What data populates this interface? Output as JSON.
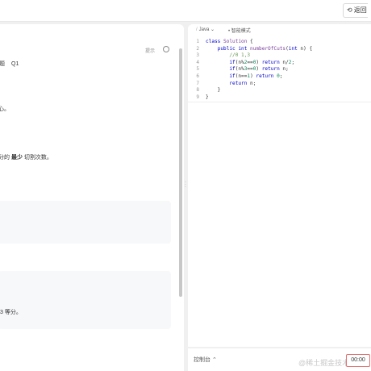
{
  "topbar": {
    "back_icon": "rotate-left-icon",
    "back_label": "返回"
  },
  "problem": {
    "hint_label": "提示",
    "title_fragment": "题",
    "title_tag": "Q1",
    "text_fragments": [
      "心。",
      "分的",
      "最少",
      "切割次数。",
      "3 等分。"
    ]
  },
  "editor": {
    "language": "Java",
    "mode": "智能模式",
    "lines": [
      {
        "no": "1",
        "tokens": [
          [
            "kw",
            "class "
          ],
          [
            "fn",
            "Solution"
          ],
          [
            "op",
            " {"
          ]
        ]
      },
      {
        "no": "2",
        "tokens": [
          [
            "op",
            "    "
          ],
          [
            "kw",
            "public int "
          ],
          [
            "fn",
            "numberOfCuts"
          ],
          [
            "op",
            "("
          ],
          [
            "kw",
            "int"
          ],
          [
            "op",
            " n) {"
          ]
        ]
      },
      {
        "no": "3",
        "tokens": [
          [
            "op",
            "        "
          ],
          [
            "cm",
            "//0 1,3"
          ]
        ]
      },
      {
        "no": "4",
        "tokens": [
          [
            "op",
            "        "
          ],
          [
            "kw",
            "if"
          ],
          [
            "op",
            "(n%"
          ],
          [
            "num",
            "2"
          ],
          [
            "op",
            "=="
          ],
          [
            "num",
            "0"
          ],
          [
            "op",
            ") "
          ],
          [
            "kw",
            "return"
          ],
          [
            "op",
            " n/"
          ],
          [
            "num",
            "2"
          ],
          [
            "op",
            ";"
          ]
        ]
      },
      {
        "no": "5",
        "tokens": [
          [
            "op",
            "        "
          ],
          [
            "kw",
            "if"
          ],
          [
            "op",
            "(n%"
          ],
          [
            "num",
            "3"
          ],
          [
            "op",
            "=="
          ],
          [
            "num",
            "0"
          ],
          [
            "op",
            ") "
          ],
          [
            "kw",
            "return"
          ],
          [
            "op",
            " n;"
          ]
        ]
      },
      {
        "no": "6",
        "tokens": [
          [
            "op",
            "        "
          ],
          [
            "kw",
            "if"
          ],
          [
            "op",
            "(n=="
          ],
          [
            "num",
            "1"
          ],
          [
            "op",
            ") "
          ],
          [
            "kw",
            "return"
          ],
          [
            "op",
            " "
          ],
          [
            "num",
            "0"
          ],
          [
            "op",
            ";"
          ]
        ]
      },
      {
        "no": "7",
        "tokens": [
          [
            "op",
            "        "
          ],
          [
            "kw",
            "return"
          ],
          [
            "op",
            " n;"
          ]
        ]
      },
      {
        "no": "8",
        "tokens": [
          [
            "op",
            "    }"
          ]
        ]
      },
      {
        "no": "9",
        "tokens": [
          [
            "op",
            "}"
          ]
        ]
      }
    ]
  },
  "console": {
    "label": "控制台",
    "toggle_icon": "chevron-up-icon",
    "timer": "00:00",
    "watermark": "@稀土掘金技术社区"
  }
}
